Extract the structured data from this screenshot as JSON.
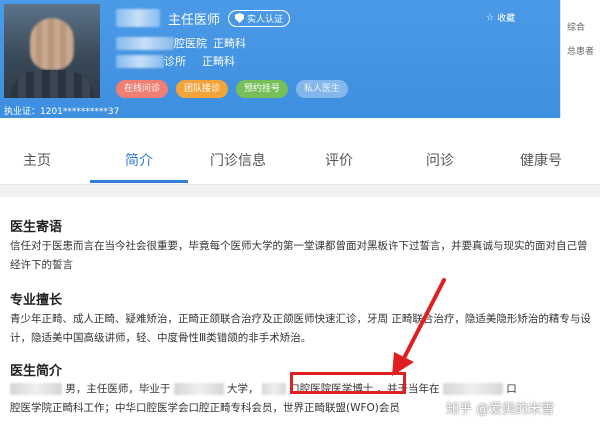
{
  "doctor": {
    "title": "主任医师",
    "verify_label": "实人认证",
    "hospital_suffix": "腔医院",
    "department": "正畸科",
    "clinic_suffix": "诊所",
    "clinic_department": "正畸科",
    "license": "执业证：1201**********37",
    "favorite_label": "收藏"
  },
  "actions": {
    "online": "在线问诊",
    "team": "团队接诊",
    "reserve": "预约挂号",
    "private": "私人医生"
  },
  "side_panel": {
    "line1": "综合",
    "line2": "总患者"
  },
  "tabs": [
    "主页",
    "简介",
    "门诊信息",
    "评价",
    "问诊",
    "健康号"
  ],
  "active_tab": "简介",
  "sections": {
    "message_title": "医生寄语",
    "message_text": "信任对于医患而言在当今社会很重要，毕竟每个医师大学的第一堂课都曾面对黑板许下过誓言，并要真诚与现实的面对自己曾经许下的誓言",
    "specialty_title": "专业擅长",
    "specialty_text": "青少年正畸、成人正畸、疑难矫治，正畸正颌联合治疗及正颌医师快速汇诊，牙周 正畸联合治疗，隐适美隐形矫治的精专与设计，隐适美中国高级讲师，轻、中度骨性Ⅲ类错颌的非手术矫治。",
    "intro_title": "医生简介",
    "intro_p1": "男，主任医师，毕业于",
    "intro_p2": "大学，",
    "intro_degree": "口腔医院医学博士",
    "intro_p3": "，并于当年在",
    "intro_p4": "口",
    "intro_line2": "腔医学院正畸科工作；中华口腔医学会口腔正畸专科会员，世界正畸联盟(WFO)会员"
  },
  "watermark": "知乎 @爱美的米雪",
  "colors": {
    "header": "#4a9ae8",
    "accent": "#2f7fd6",
    "highlight": "#e02020"
  }
}
